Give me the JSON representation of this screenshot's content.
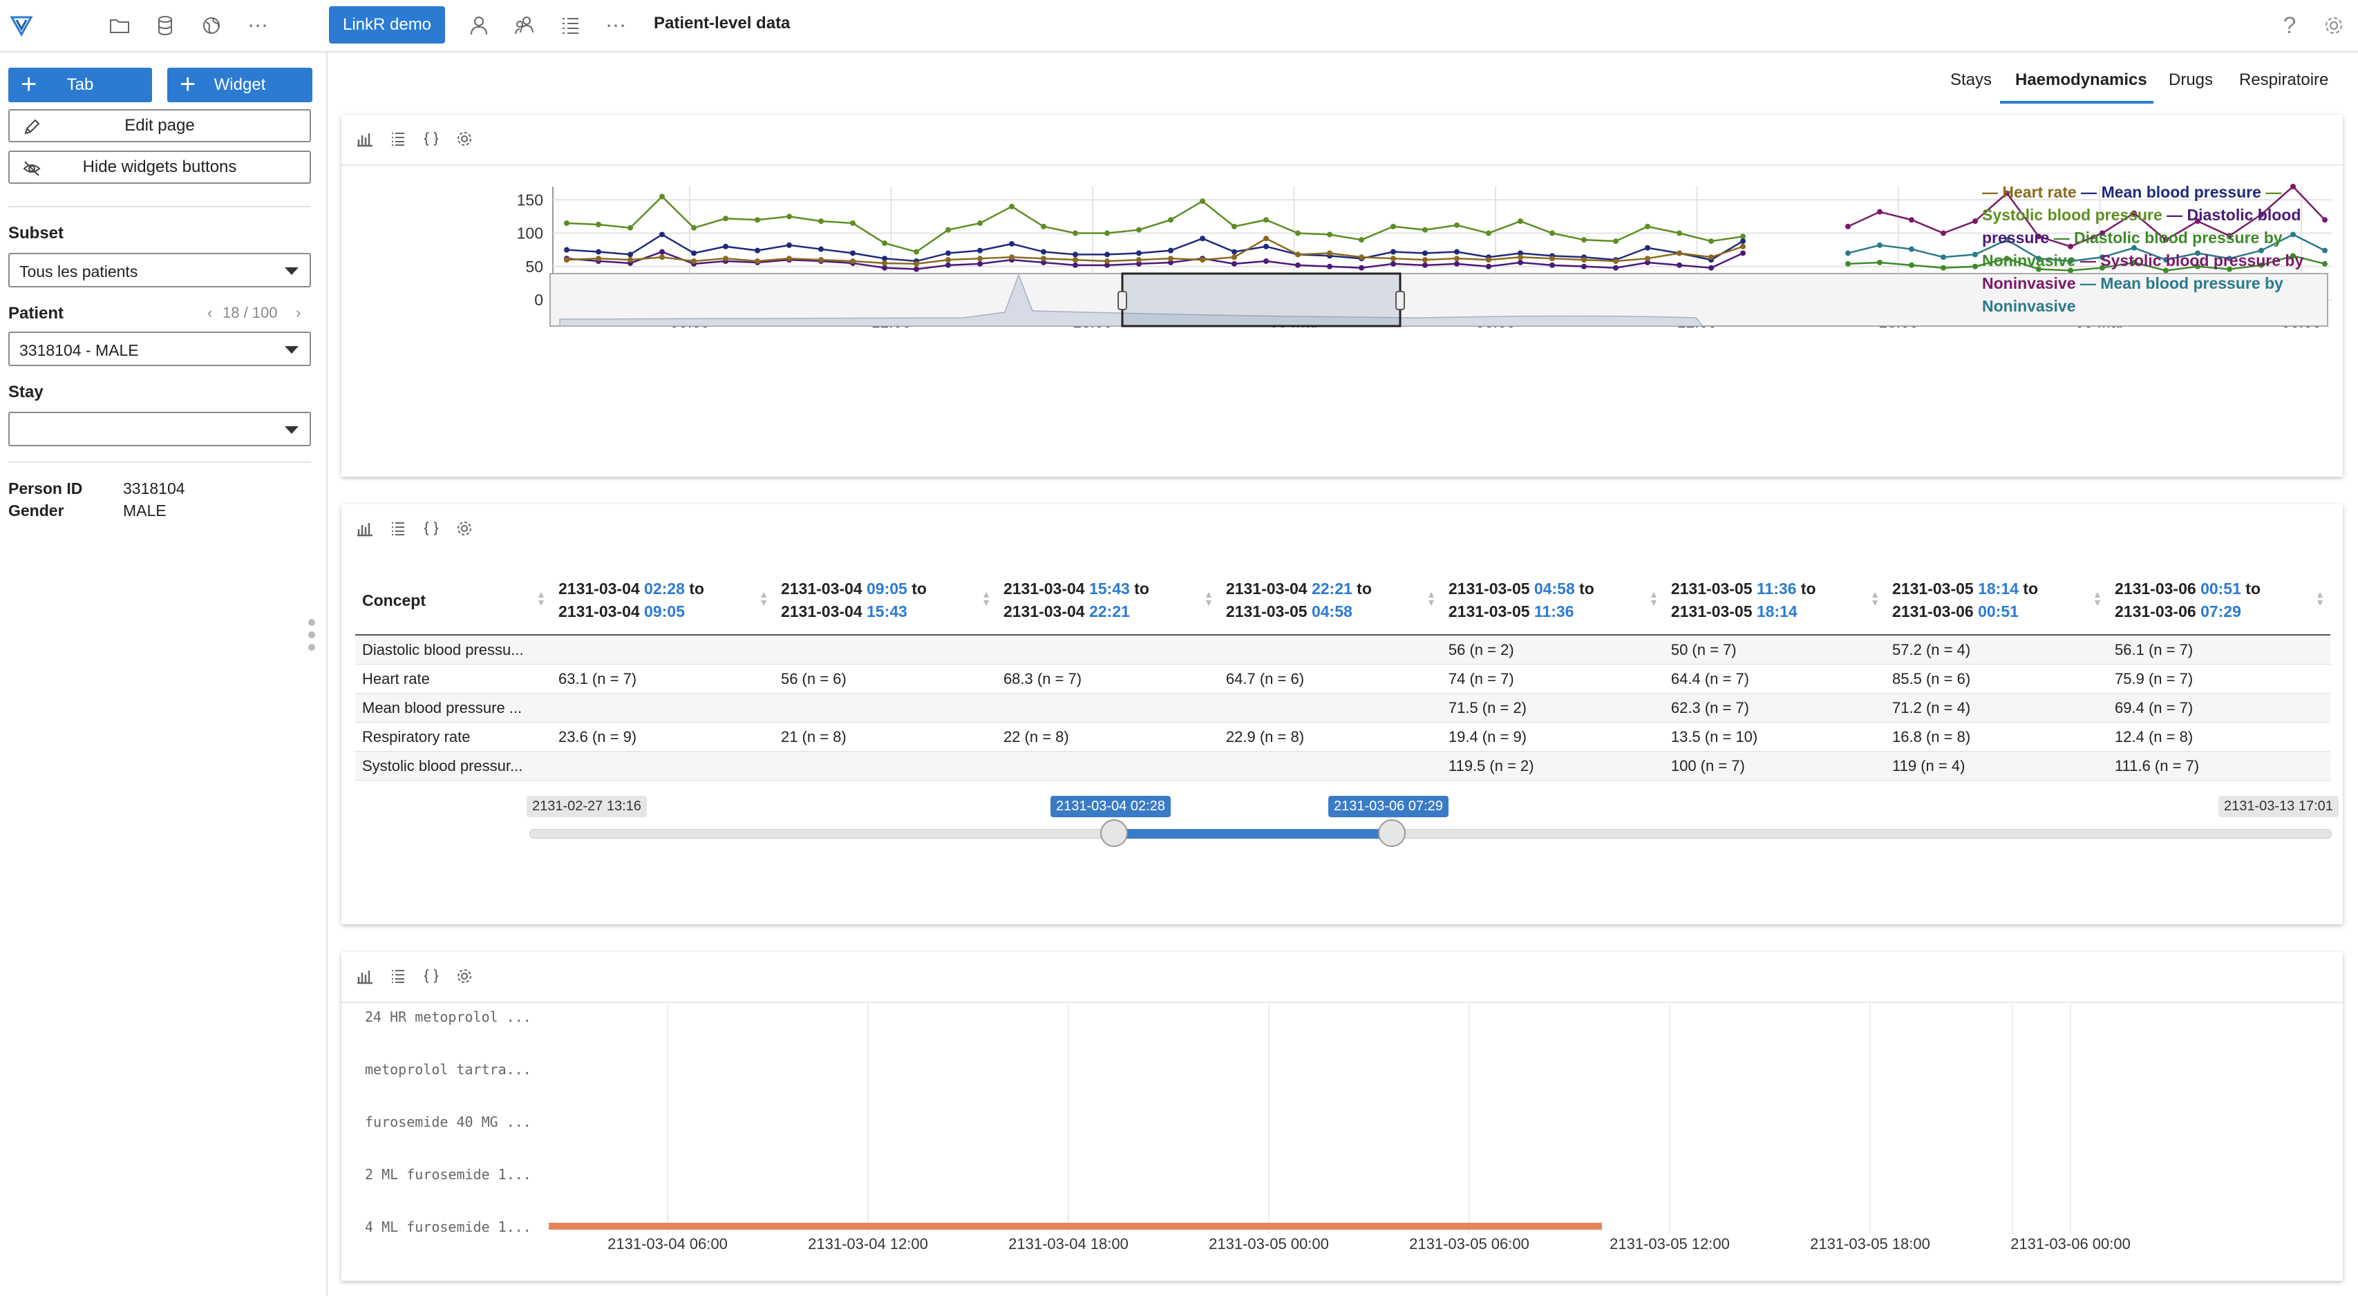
{
  "topbar": {
    "demo_button": "LinkR demo",
    "page_title": "Patient-level data",
    "more_dots": "⋯",
    "help": "?"
  },
  "sidebar": {
    "tab_button": "Tab",
    "widget_button": "Widget",
    "edit_page": "Edit page",
    "hide_widgets": "Hide widgets buttons",
    "subset_label": "Subset",
    "subset_value": "Tous les patients",
    "patient_label": "Patient",
    "patient_counter": "18 / 100",
    "patient_value": "3318104 - MALE",
    "stay_label": "Stay",
    "stay_value": "",
    "person_id_key": "Person ID",
    "person_id_val": "3318104",
    "gender_key": "Gender",
    "gender_val": "MALE"
  },
  "tabs": [
    "Stays",
    "Haemodynamics",
    "Drugs",
    "Respiratoire"
  ],
  "active_tab": "Haemodynamics",
  "timeseries": {
    "legend_text": [
      "Heart rate",
      "Mean blood pressure",
      "Systolic blood pressure",
      "Diastolic blood pressure",
      "Diastolic blood pressure by Noninvasive",
      "Systolic blood pressure by Noninvasive",
      "Mean blood pressure by Noninvasive"
    ],
    "chart_data": {
      "type": "line",
      "y_ticks": [
        "0",
        "50",
        "100",
        "150"
      ],
      "x_ticks": [
        "06:00",
        "12:00",
        "18:00",
        "05 Mar",
        "06:00",
        "12:00",
        "18:00",
        "06 Mar",
        "06:00"
      ],
      "ylim": [
        0,
        170
      ],
      "series": [
        {
          "name": "Heart rate",
          "color": "#8a6a1e"
        },
        {
          "name": "Mean blood pressure",
          "color": "#1f2a7a"
        },
        {
          "name": "Systolic blood pressure",
          "color": "#5e8e23"
        },
        {
          "name": "Diastolic blood pressure",
          "color": "#4a1a7a"
        },
        {
          "name": "Diastolic blood pressure by Noninvasive",
          "color": "#3e8a2a"
        },
        {
          "name": "Systolic blood pressure by Noninvasive",
          "color": "#7a1a6a"
        },
        {
          "name": "Mean blood pressure by Noninvasive",
          "color": "#2a7a8a"
        }
      ]
    }
  },
  "table": {
    "concept_header": "Concept",
    "columns": [
      {
        "d1": "2131-03-04",
        "t1": "02:28",
        "to": "to",
        "d2": "2131-03-04",
        "t2": "09:05"
      },
      {
        "d1": "2131-03-04",
        "t1": "09:05",
        "to": "to",
        "d2": "2131-03-04",
        "t2": "15:43"
      },
      {
        "d1": "2131-03-04",
        "t1": "15:43",
        "to": "to",
        "d2": "2131-03-04",
        "t2": "22:21"
      },
      {
        "d1": "2131-03-04",
        "t1": "22:21",
        "to": "to",
        "d2": "2131-03-05",
        "t2": "04:58"
      },
      {
        "d1": "2131-03-05",
        "t1": "04:58",
        "to": "to",
        "d2": "2131-03-05",
        "t2": "11:36"
      },
      {
        "d1": "2131-03-05",
        "t1": "11:36",
        "to": "to",
        "d2": "2131-03-05",
        "t2": "18:14"
      },
      {
        "d1": "2131-03-05",
        "t1": "18:14",
        "to": "to",
        "d2": "2131-03-06",
        "t2": "00:51"
      },
      {
        "d1": "2131-03-06",
        "t1": "00:51",
        "to": "to",
        "d2": "2131-03-06",
        "t2": "07:29"
      }
    ],
    "rows": [
      {
        "concept": "Diastolic blood pressu...",
        "cells": [
          "",
          "",
          "",
          "",
          "56 (n = 2)",
          "50 (n = 7)",
          "57.2 (n = 4)",
          "56.1 (n = 7)"
        ]
      },
      {
        "concept": "Heart rate",
        "cells": [
          "63.1 (n = 7)",
          "56 (n = 6)",
          "68.3 (n = 7)",
          "64.7 (n = 6)",
          "74 (n = 7)",
          "64.4 (n = 7)",
          "85.5 (n = 6)",
          "75.9 (n = 7)"
        ]
      },
      {
        "concept": "Mean blood pressure ...",
        "cells": [
          "",
          "",
          "",
          "",
          "71.5 (n = 2)",
          "62.3 (n = 7)",
          "71.2 (n = 4)",
          "69.4 (n = 7)"
        ]
      },
      {
        "concept": "Respiratory rate",
        "cells": [
          "23.6 (n = 9)",
          "21 (n = 8)",
          "22 (n = 8)",
          "22.9 (n = 8)",
          "19.4 (n = 9)",
          "13.5 (n = 10)",
          "16.8 (n = 8)",
          "12.4 (n = 8)"
        ]
      },
      {
        "concept": "Systolic blood pressur...",
        "cells": [
          "",
          "",
          "",
          "",
          "119.5 (n = 2)",
          "100 (n = 7)",
          "119 (n = 4)",
          "111.6 (n = 7)"
        ]
      }
    ],
    "slider": {
      "min": "2131-02-27 13:16",
      "from": "2131-03-04 02:28",
      "to": "2131-03-06 07:29",
      "max": "2131-03-13 17:01"
    }
  },
  "drugs": {
    "labels": [
      "24 HR metoprolol ...",
      "metoprolol tartra...",
      "furosemide 40 MG ...",
      "2 ML furosemide 1...",
      "4 ML furosemide 1..."
    ],
    "x_ticks": [
      "2131-03-04 06:00",
      "2131-03-04 12:00",
      "2131-03-04 18:00",
      "2131-03-05 00:00",
      "2131-03-05 06:00",
      "2131-03-05 12:00",
      "2131-03-05 18:00",
      "2131-03-06 00:00"
    ],
    "bar_color": "#e8845a"
  }
}
